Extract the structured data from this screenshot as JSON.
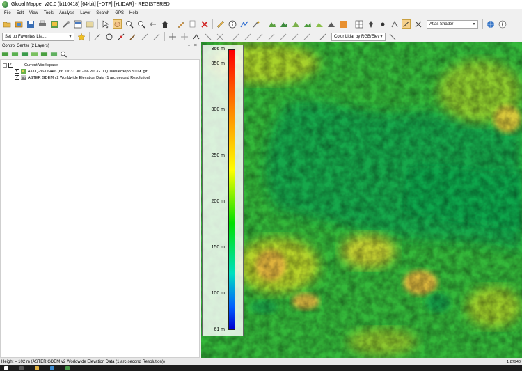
{
  "window": {
    "title": "Global Mapper v20.0 (b110418) [64-bit] [+OTF] [+LIDAR] - REGISTERED"
  },
  "menu": [
    "File",
    "Edit",
    "View",
    "Tools",
    "Analysis",
    "Layer",
    "Search",
    "GPS",
    "Help"
  ],
  "toolbar": {
    "shader_combo": "Atlas Shader",
    "favorites_combo": "Set up Favorites List...",
    "lidar_color_combo": "Color Lidar by RGB/Elev"
  },
  "control_center": {
    "title": "Control Center (2 Layers)",
    "workspace_label": "Current Workspace",
    "layers": [
      {
        "name": "433 Q-36-064A6 (66 10'  31 30' - 66 20'  32 00') Тикшеозеро 500м .gif",
        "checked": true
      },
      {
        "name": "ASTER GDEM v2 Worldwide Elevation Data (1 arc-second Resolution)",
        "checked": true
      }
    ]
  },
  "legend": {
    "labels": [
      "366 m",
      "350 m",
      "300 m",
      "250 m",
      "200 m",
      "150 m",
      "100 m",
      "61 m"
    ],
    "values": [
      366,
      350,
      300,
      250,
      200,
      150,
      100,
      61
    ],
    "min": 61,
    "max": 366
  },
  "status": {
    "left": "Height = 102 m (ASTER GDEM v2 Worldwide Elevation Data (1 arc-second Resolution))",
    "right": "1:87940"
  },
  "colors": {
    "map_water": "#17a64a",
    "map_low": "#2fb83a",
    "map_mid": "#9fd02a",
    "map_high": "#e0b83c"
  }
}
